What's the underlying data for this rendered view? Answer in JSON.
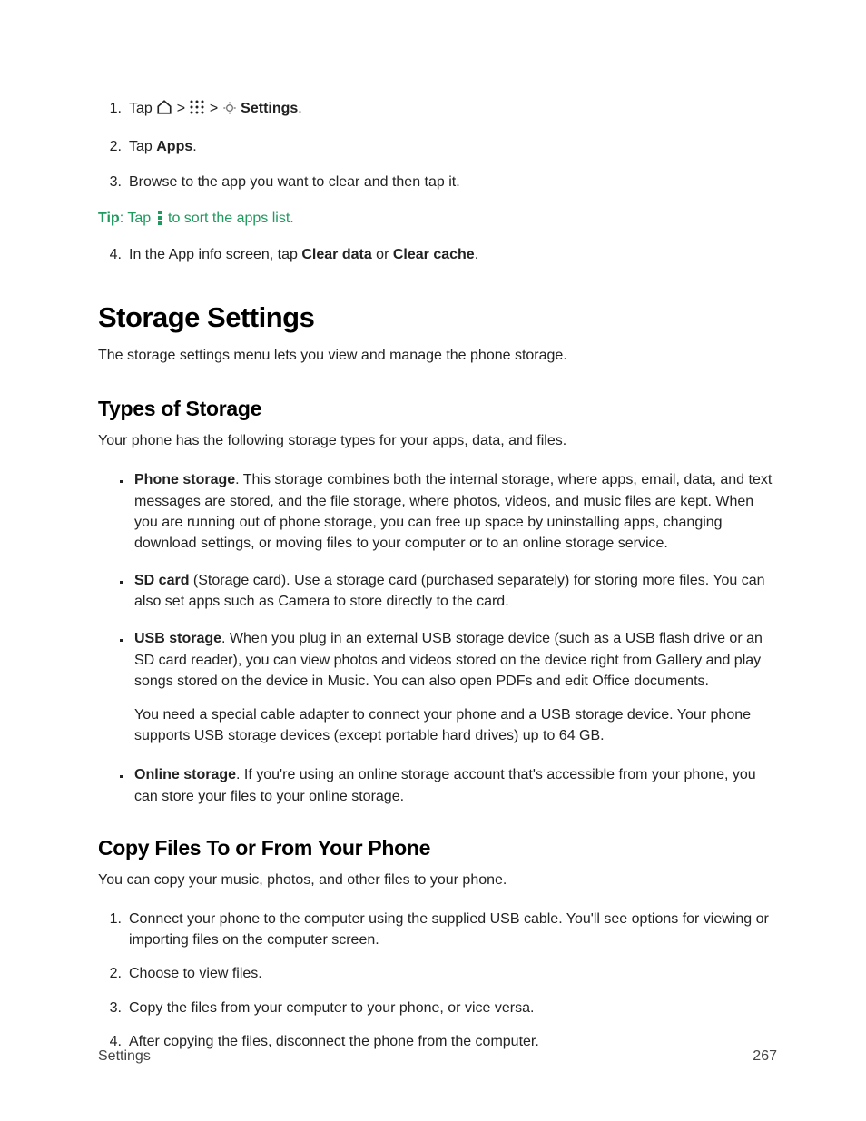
{
  "steps_a": {
    "s1_prefix": "Tap ",
    "s1_settings_bold": "Settings",
    "s1_period": ".",
    "s2_prefix": "Tap ",
    "s2_apps_bold": "Apps",
    "s2_period": ".",
    "s3": "Browse to the app you want to clear and then tap it.",
    "s4_prefix": "In the App info screen, tap ",
    "s4_bold1": "Clear data",
    "s4_mid": " or ",
    "s4_bold2": "Clear cache",
    "s4_period": "."
  },
  "tip": {
    "label": "Tip",
    "colon": ": ",
    "before": "Tap ",
    "after": " to sort the apps list."
  },
  "h1": "Storage Settings",
  "p_intro": "The storage settings menu lets you view and manage the phone storage.",
  "h2_types": "Types of Storage",
  "p_types_intro": "Your phone has the following storage types for your apps, data, and files.",
  "types": {
    "t1_bold": "Phone storage",
    "t1_rest": ". This storage combines both the internal storage, where apps, email, data, and text messages are stored, and the file storage, where photos, videos, and music files are kept. When you are running out of phone storage, you can free up space by uninstalling apps, changing download settings, or moving files to your computer or to an online storage service.",
    "t2_bold": "SD card",
    "t2_rest": " (Storage card). Use a storage card (purchased separately) for storing more files. You can also set apps such as Camera to store directly to the card.",
    "t3_bold": "USB storage",
    "t3_rest": ". When you plug in an external USB storage device (such as a USB flash drive or an SD card reader), you can view photos and videos stored on the device right from Gallery and play songs stored on the device in Music. You can also open PDFs and edit Office documents.",
    "t3_extra": "You need a special cable adapter to connect your phone and a USB storage device. Your phone supports USB storage devices (except portable hard drives) up to 64 GB.",
    "t4_bold": "Online storage",
    "t4_rest": ". If you're using an online storage account that's accessible from your phone, you can store your files to your online storage."
  },
  "h2_copy": "Copy Files To or From Your Phone",
  "p_copy_intro": "You can copy your music, photos, and other files to your phone.",
  "copy_steps": {
    "c1": "Connect your phone to the computer using the supplied USB cable. You'll see options for viewing or importing files on the computer screen.",
    "c2": "Choose to view files.",
    "c3": "Copy the files from your computer to your phone, or vice versa.",
    "c4": "After copying the files, disconnect the phone from the computer."
  },
  "footer": {
    "section": "Settings",
    "page": "267"
  }
}
